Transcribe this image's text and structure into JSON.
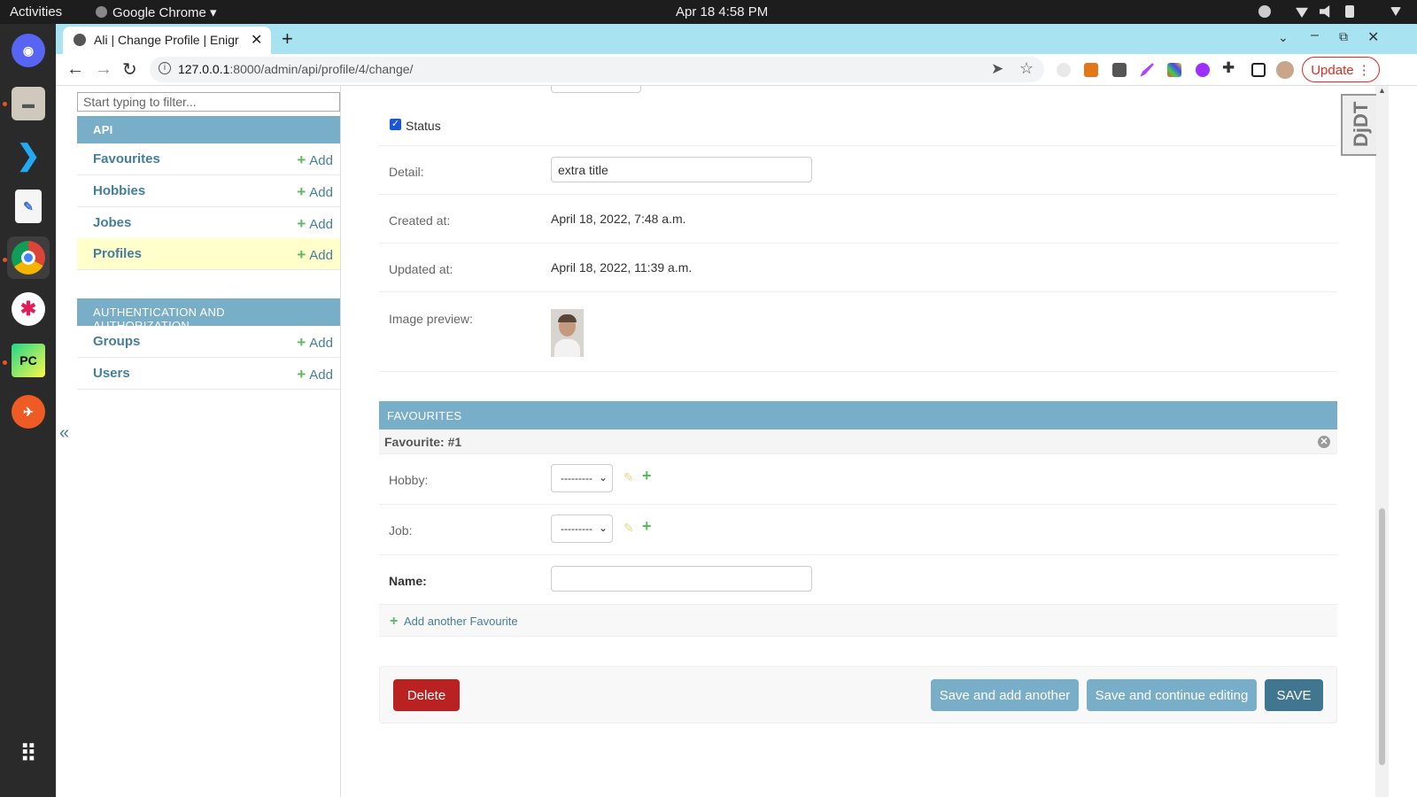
{
  "topbar": {
    "activities": "Activities",
    "app": "Google Chrome",
    "clock": "Apr 18  4:58 PM"
  },
  "dock": {
    "apps": [
      "Discord",
      "Files",
      "VS Code",
      "Text Editor",
      "Chrome",
      "Slack",
      "PyCharm",
      "Postman"
    ]
  },
  "browser": {
    "tab_title": "Ali | Change Profile | Enigr",
    "url_host": "127.0.0.1",
    "url_rest": ":8000/admin/api/profile/4/change/",
    "update_label": "Update"
  },
  "sidebar": {
    "filter_placeholder": "Start typing to filter...",
    "api_caption": "API",
    "api_models": [
      {
        "label": "Favourites",
        "add": "Add"
      },
      {
        "label": "Hobbies",
        "add": "Add"
      },
      {
        "label": "Jobes",
        "add": "Add"
      },
      {
        "label": "Profiles",
        "add": "Add"
      }
    ],
    "auth_caption": "AUTHENTICATION AND AUTHORIZATION",
    "auth_models": [
      {
        "label": "Groups",
        "add": "Add"
      },
      {
        "label": "Users",
        "add": "Add"
      }
    ],
    "collapse": "«"
  },
  "form": {
    "status_label": "Status",
    "status_checked": true,
    "detail_label": "Detail:",
    "detail_value": "extra title",
    "created_label": "Created at:",
    "created_value": "April 18, 2022, 7:48 a.m.",
    "updated_label": "Updated at:",
    "updated_value": "April 18, 2022, 11:39 a.m.",
    "image_label": "Image preview:"
  },
  "favourites": {
    "caption": "FAVOURITES",
    "item_title": "Favourite: #1",
    "hobby_label": "Hobby:",
    "hobby_value": "---------",
    "job_label": "Job:",
    "job_value": "---------",
    "name_label": "Name:",
    "name_value": "",
    "add_another": "Add another Favourite"
  },
  "submit": {
    "delete": "Delete",
    "save_add": "Save and add another",
    "save_continue": "Save and continue editing",
    "save": "SAVE"
  },
  "djdt": "DjDT",
  "colors": {
    "caption": "#79aec8",
    "link": "#447e9b",
    "delete": "#ba2121",
    "save": "#417690"
  }
}
